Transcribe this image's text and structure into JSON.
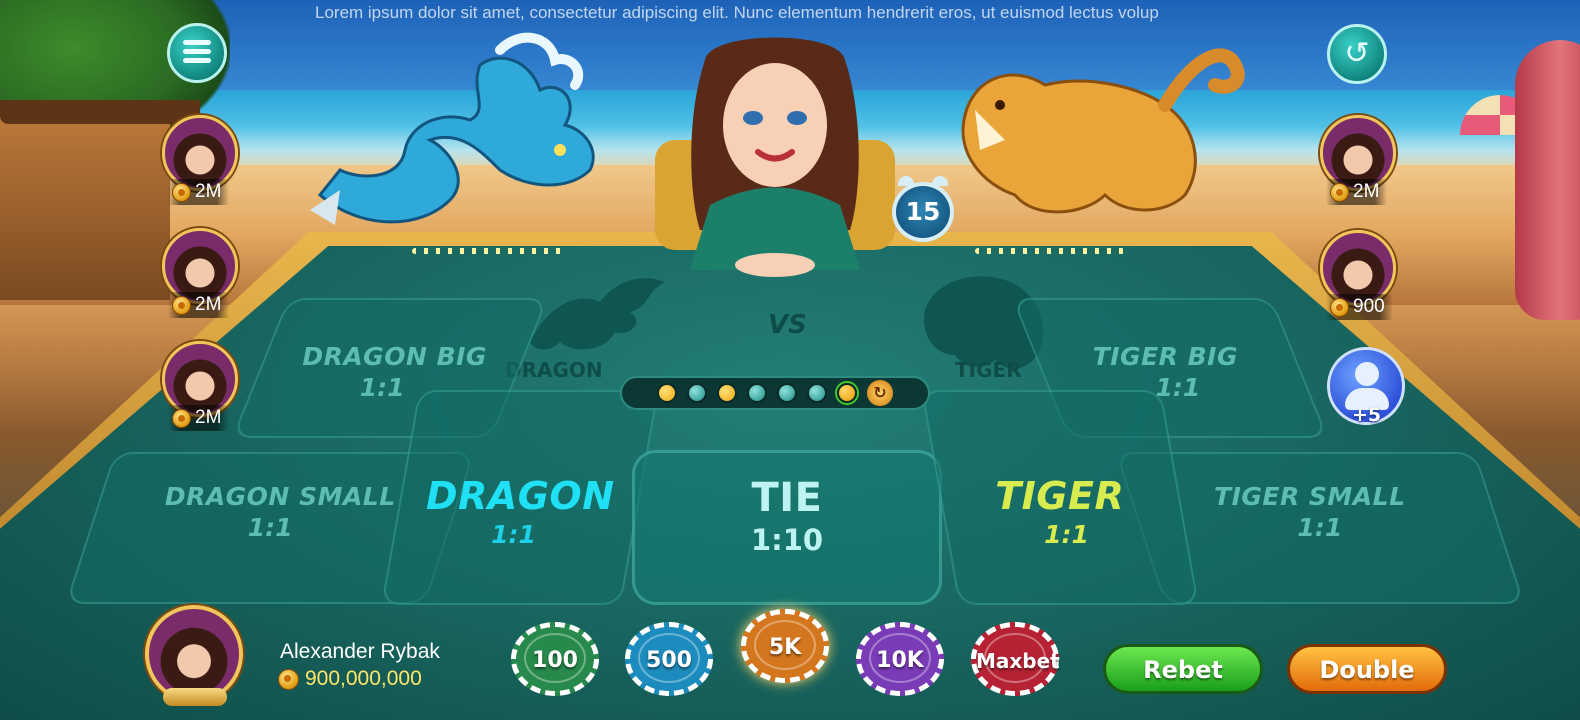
{
  "ticker": {
    "text": "Lorem ipsum dolor sit amet, consectetur adipiscing elit. Nunc elementum hendrerit eros, ut euismod lectus volup"
  },
  "timer": {
    "seconds": "15"
  },
  "table": {
    "vs_label": "VS",
    "dragon_emblem_label": "DRAGON",
    "tiger_emblem_label": "TIGER",
    "zones": {
      "dragon_big": {
        "name": "DRAGON BIG",
        "odds": "1:1"
      },
      "tiger_big": {
        "name": "TIGER BIG",
        "odds": "1:1"
      },
      "dragon_small": {
        "name": "DRAGON SMALL",
        "odds": "1:1"
      },
      "tiger_small": {
        "name": "TIGER SMALL",
        "odds": "1:1"
      },
      "dragon": {
        "name": "DRAGON",
        "odds": "1:1"
      },
      "tie": {
        "name": "TIE",
        "odds": "1:10"
      },
      "tiger": {
        "name": "TIGER",
        "odds": "1:1"
      }
    },
    "road_beads": [
      "gold",
      "teal",
      "gold",
      "teal",
      "teal",
      "teal",
      "gold-win"
    ]
  },
  "left_players": [
    {
      "amount": "2M"
    },
    {
      "amount": "2M"
    },
    {
      "amount": "2M"
    }
  ],
  "right_players": [
    {
      "amount": "2M"
    },
    {
      "amount": "900"
    }
  ],
  "more_players": {
    "count": "+5"
  },
  "me": {
    "name": "Alexander Rybak",
    "balance": "900,000,000"
  },
  "chips": [
    {
      "label": "100",
      "color": "#27894b"
    },
    {
      "label": "500",
      "color": "#1c8bbd"
    },
    {
      "label": "5K",
      "color": "#d4761e",
      "selected": true
    },
    {
      "label": "10K",
      "color": "#7a3bb7"
    },
    {
      "label": "Maxbet",
      "color": "#b62234"
    }
  ],
  "actions": {
    "rebet": "Rebet",
    "double": "Double"
  },
  "icons": {
    "menu": "hamburger-icon",
    "history": "history-icon",
    "timer": "alarm-clock-icon",
    "coin": "coin-icon",
    "more": "user-icon"
  },
  "colors": {
    "dragon": "#1fe0f5",
    "tiger": "#d9ec4f",
    "felt": "#17625c",
    "gold": "#f2c55a"
  }
}
